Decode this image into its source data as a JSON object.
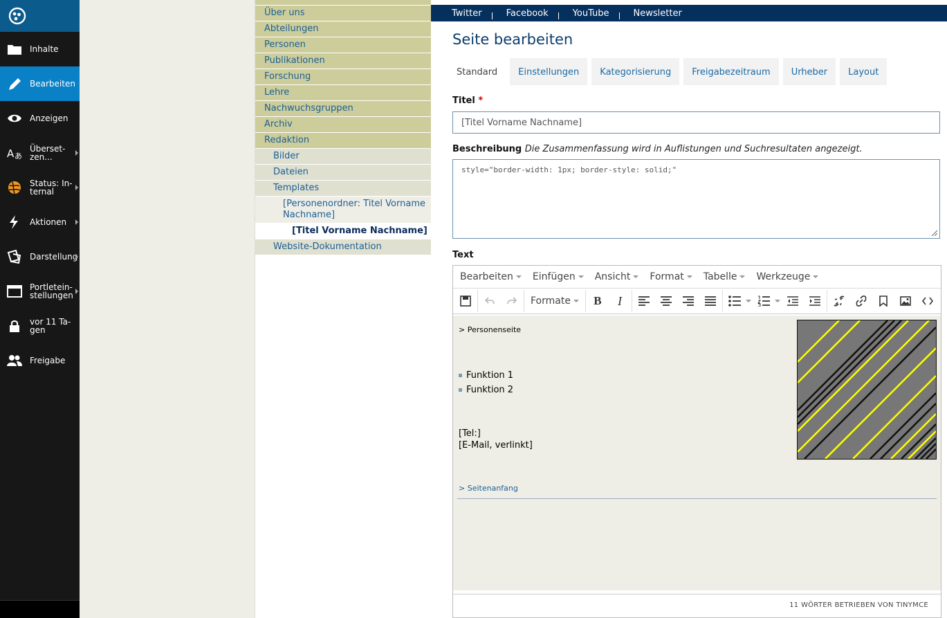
{
  "sidebar": {
    "items": [
      {
        "label": "Inhalte",
        "icon": "folder-icon",
        "active": false,
        "arrow": false
      },
      {
        "label": "Bearbeiten",
        "icon": "pencil-icon",
        "active": true,
        "arrow": false
      },
      {
        "label": "Anzeigen",
        "icon": "eye-icon",
        "active": false,
        "arrow": false
      },
      {
        "label": "Überset-\nzen...",
        "icon": "translate-icon",
        "active": false,
        "arrow": true
      },
      {
        "label": "Status: In-\nternal",
        "icon": "status-icon",
        "active": false,
        "arrow": true
      },
      {
        "label": "Aktionen",
        "icon": "lightning-icon",
        "active": false,
        "arrow": true
      },
      {
        "label": "Darstellung",
        "icon": "display-icon",
        "active": false,
        "arrow": true
      },
      {
        "label": "Portletein-\nstellungen",
        "icon": "window-icon",
        "active": false,
        "arrow": true
      },
      {
        "label": "vor 11 Ta-\ngen",
        "icon": "lock-icon",
        "active": false,
        "arrow": false
      },
      {
        "label": "Freigabe",
        "icon": "users-icon",
        "active": false,
        "arrow": false
      }
    ]
  },
  "nav": {
    "items": [
      {
        "label": "Über uns",
        "level": 0
      },
      {
        "label": "Abteilungen",
        "level": 0
      },
      {
        "label": "Personen",
        "level": 0
      },
      {
        "label": "Publikationen",
        "level": 0
      },
      {
        "label": "Forschung",
        "level": 0
      },
      {
        "label": "Lehre",
        "level": 0
      },
      {
        "label": "Nachwuchsgruppen",
        "level": 0
      },
      {
        "label": "Archiv",
        "level": 0
      },
      {
        "label": "Redaktion",
        "level": 0
      },
      {
        "label": "Bilder",
        "level": 1
      },
      {
        "label": "Dateien",
        "level": 1
      },
      {
        "label": "Templates",
        "level": 1
      },
      {
        "label": "[Personenordner: Titel Vorname Nachname]",
        "level": 2
      },
      {
        "label": "[Titel Vorname Nachname]",
        "level": 3
      },
      {
        "label": "Website-Dokumentation",
        "level": 1
      }
    ]
  },
  "topbar": {
    "links": [
      "Twitter",
      "Facebook",
      "YouTube",
      "Newsletter"
    ]
  },
  "page": {
    "title": "Seite bearbeiten",
    "tabs": [
      "Standard",
      "Einstellungen",
      "Kategorisierung",
      "Freigabezeitraum",
      "Urheber",
      "Layout"
    ],
    "active_tab": "Standard"
  },
  "form": {
    "title_label": "Titel",
    "required_mark": "*",
    "title_value": "[Titel Vorname Nachname]",
    "desc_label": "Beschreibung",
    "desc_help": "Die Zusammenfassung wird in Auflistungen und Suchresultaten angezeigt.",
    "desc_value": "style=\"border-width: 1px; border-style: solid;\"",
    "text_label": "Text"
  },
  "editor": {
    "menus": [
      "Bearbeiten",
      "Einfügen",
      "Ansicht",
      "Format",
      "Tabelle",
      "Werkzeuge"
    ],
    "formats_label": "Formate",
    "breadcrumb": "> Personenseite",
    "list_items": [
      "Funktion 1",
      "Funktion 2"
    ],
    "tel": "[Tel:]",
    "email": "[E-Mail, verlinkt]",
    "top_link": "> Seitenanfang",
    "status": "11 WÖRTER BETRIEBEN VON TINYMCE"
  }
}
